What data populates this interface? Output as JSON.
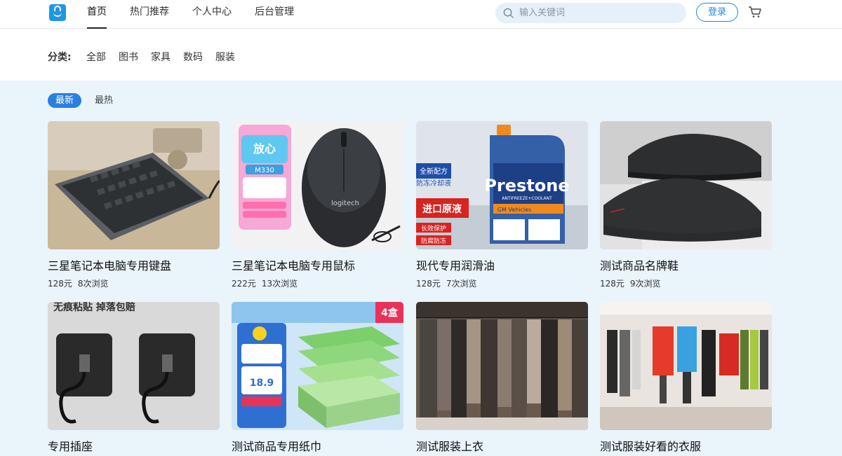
{
  "header": {
    "nav": [
      {
        "label": "首页",
        "active": true
      },
      {
        "label": "热门推荐",
        "active": false
      },
      {
        "label": "个人中心",
        "active": false
      },
      {
        "label": "后台管理",
        "active": false
      }
    ],
    "search_placeholder": "输入关键词",
    "login_label": "登录"
  },
  "category": {
    "label": "分类:",
    "items": [
      "全部",
      "图书",
      "家具",
      "数码",
      "服装"
    ]
  },
  "sort_tabs": [
    {
      "label": "最新",
      "active": true
    },
    {
      "label": "最热",
      "active": false
    }
  ],
  "products": [
    {
      "name": "三星笔记本电脑专用键盘",
      "price": "128元",
      "views": "8次浏览",
      "image": "keyboard"
    },
    {
      "name": "三星笔记本电脑专用鼠标",
      "price": "222元",
      "views": "13次浏览",
      "image": "mouse"
    },
    {
      "name": "现代专用润滑油",
      "price": "128元",
      "views": "7次浏览",
      "image": "oil-bottle"
    },
    {
      "name": "测试商品名牌鞋",
      "price": "128元",
      "views": "9次浏览",
      "image": "sneakers"
    },
    {
      "name": "专用插座",
      "price": "",
      "views": "",
      "image": "wall-hooks"
    },
    {
      "name": "测试商品专用纸巾",
      "price": "",
      "views": "",
      "image": "tissue-boxes"
    },
    {
      "name": "测试服装上衣",
      "price": "",
      "views": "",
      "image": "clothing-rack"
    },
    {
      "name": "测试服装好看的衣服",
      "price": "",
      "views": "",
      "image": "clothing-store"
    }
  ],
  "image_text": {
    "mouse_brand": "logitech",
    "mouse_promo_model": "M330",
    "oil_brand": "Prestone",
    "oil_sub": "ANTIFREEZE+COOLANT",
    "oil_sub2": "GM Vehicles",
    "oil_badge1": "全新配方",
    "oil_badge2": "防冻冷却液",
    "oil_badge3": "进口原液",
    "oil_badge4": "长效保护",
    "oil_badge5": "防腐防冻",
    "hook_headline": "无痕粘贴 掉落包赔",
    "tissue_price": "18.9",
    "tissue_count": "4盒"
  },
  "colors": {
    "accent": "#1e86e0",
    "active_tab": "#2b7fe0",
    "page_bg": "#eaf4fb",
    "search_bg": "#e6f0fa"
  }
}
